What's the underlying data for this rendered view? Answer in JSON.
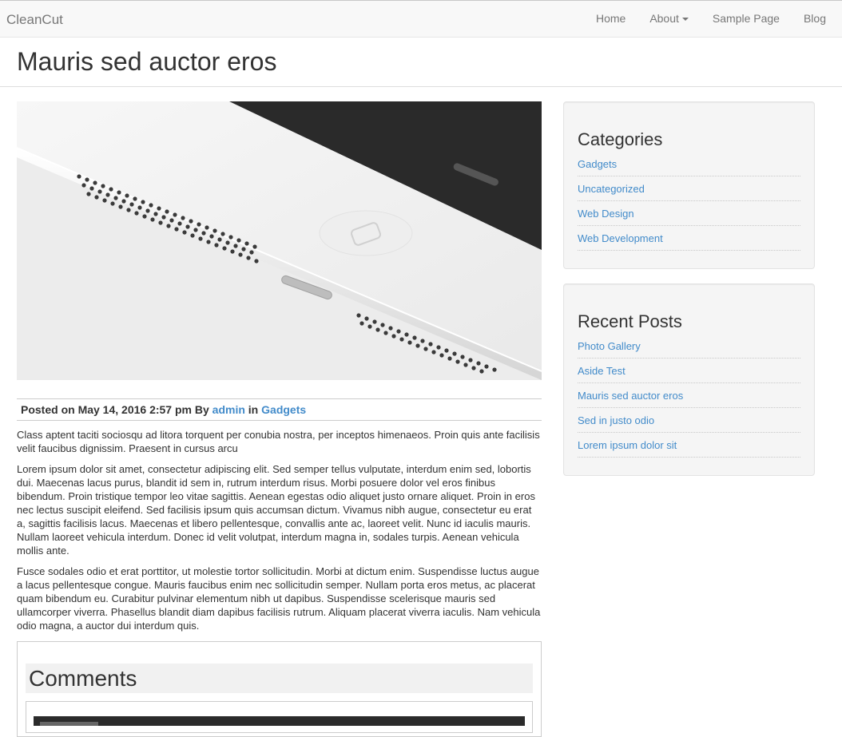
{
  "navbar": {
    "brand": "CleanCut",
    "items": [
      {
        "label": "Home",
        "dropdown": false
      },
      {
        "label": "About",
        "dropdown": true
      },
      {
        "label": "Sample Page",
        "dropdown": false
      },
      {
        "label": "Blog",
        "dropdown": false
      }
    ]
  },
  "page": {
    "title": "Mauris sed auctor eros"
  },
  "post": {
    "meta": {
      "posted_prefix": "Posted on",
      "date": "May 14, 2016 2:57 pm",
      "by": "By",
      "author": "admin",
      "in": "in",
      "category": "Gadgets"
    },
    "paragraphs": [
      "Class aptent taciti sociosqu ad litora torquent per conubia nostra, per inceptos himenaeos. Proin quis ante facilisis velit faucibus dignissim. Praesent in cursus arcu",
      "Lorem ipsum dolor sit amet, consectetur adipiscing elit. Sed semper tellus vulputate, interdum enim sed, lobortis dui. Maecenas lacus purus, blandit id sem in, rutrum interdum risus. Morbi posuere dolor vel eros finibus bibendum. Proin tristique tempor leo vitae sagittis. Aenean egestas odio aliquet justo ornare aliquet. Proin in eros nec lectus suscipit eleifend. Sed facilisis ipsum quis accumsan dictum. Vivamus nibh augue, consectetur eu erat a, sagittis facilisis lacus. Maecenas et libero pellentesque, convallis ante ac, laoreet velit. Nunc id iaculis mauris. Nullam laoreet vehicula interdum. Donec id velit volutpat, interdum magna in, sodales turpis. Aenean vehicula mollis ante.",
      "Fusce sodales odio et erat porttitor, ut molestie tortor sollicitudin. Morbi at dictum enim. Suspendisse luctus augue a lacus pellentesque congue. Mauris faucibus enim nec sollicitudin semper. Nullam porta eros metus, ac placerat quam bibendum eu. Curabitur pulvinar elementum nibh ut dapibus. Suspendisse scelerisque mauris sed ullamcorper viverra. Phasellus blandit diam dapibus facilisis rutrum. Aliquam placerat viverra iaculis. Nam vehicula odio magna, a auctor dui interdum quis."
    ],
    "comments_title": "Comments"
  },
  "sidebar": {
    "categories": {
      "title": "Categories",
      "items": [
        "Gadgets",
        "Uncategorized",
        "Web Design",
        "Web Development"
      ]
    },
    "recent_posts": {
      "title": "Recent Posts",
      "items": [
        "Photo Gallery",
        "Aside Test",
        "Mauris sed auctor eros",
        "Sed in justo odio",
        "Lorem ipsum dolor sit"
      ]
    }
  },
  "colors": {
    "link": "#428bca",
    "navbar_bg": "#f8f8f8",
    "widget_bg": "#f5f5f5"
  }
}
